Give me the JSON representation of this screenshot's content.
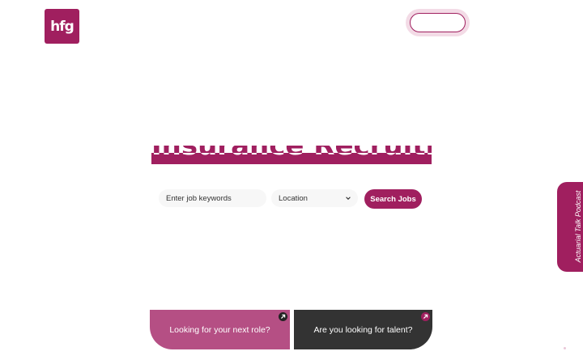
{
  "brand": {
    "logo_text": "hfg",
    "accent_color": "#a01f5f"
  },
  "hero": {
    "title": "Insurance Recruitment"
  },
  "search": {
    "keywords_placeholder": "Enter job keywords",
    "location_selected": "Location",
    "search_label": "Search Jobs"
  },
  "side_tab": {
    "label": "Actuarial Talk Podcast"
  },
  "cards": {
    "role_label": "Looking for your next role?",
    "talent_label": "Are you looking for talent?"
  },
  "icons": {
    "dropdown": "chevron-down-icon",
    "card_link": "arrow-up-right-icon"
  }
}
